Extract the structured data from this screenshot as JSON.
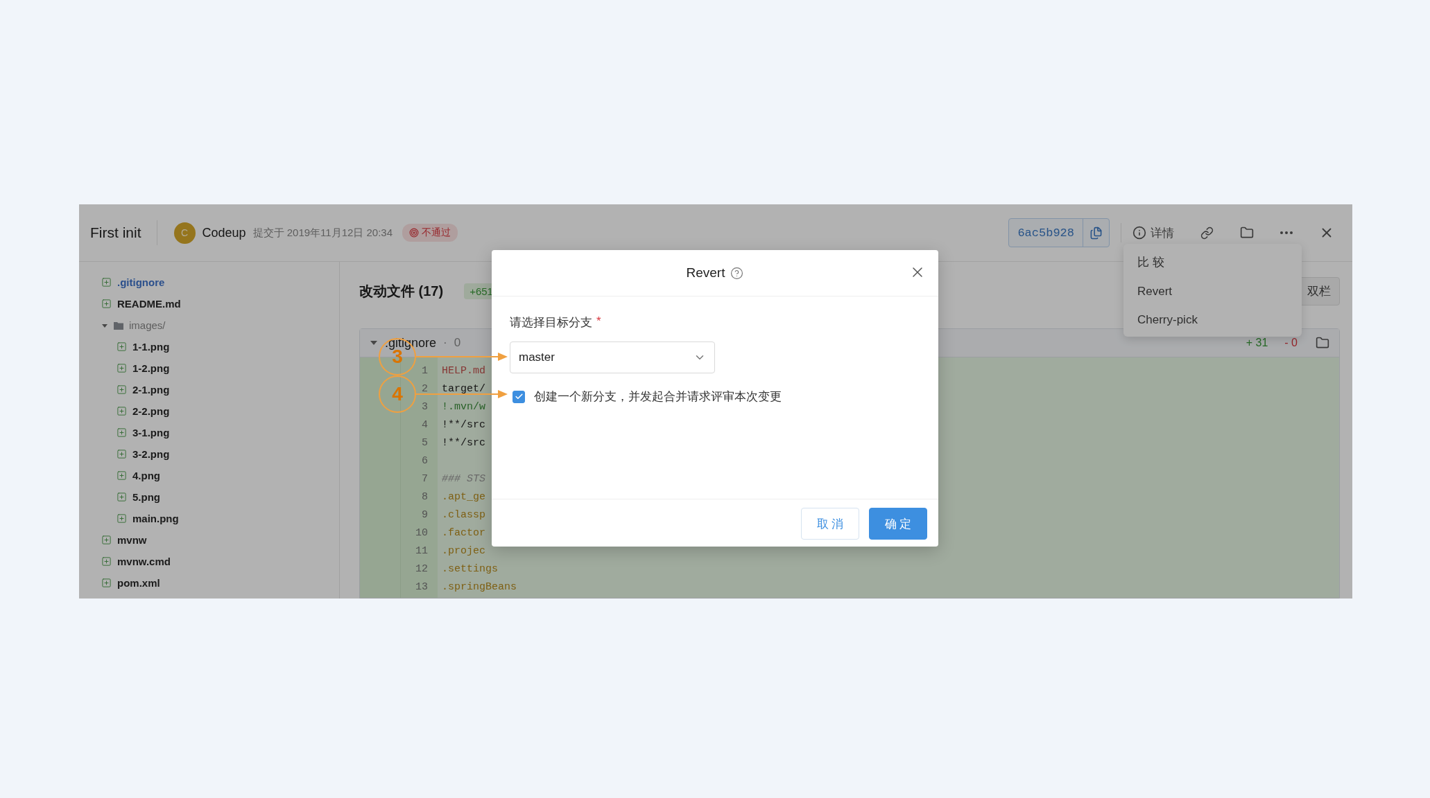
{
  "commit": {
    "title": "First init",
    "author_initial": "C",
    "author": "Codeup",
    "committed_at": "提交于 2019年11月12日 20:34",
    "status": "不通过",
    "hash": "6ac5b928"
  },
  "toolbar": {
    "details": "详情"
  },
  "more_menu": {
    "items": [
      {
        "label": "比 较"
      },
      {
        "label": "Revert"
      },
      {
        "label": "Cherry-pick"
      }
    ]
  },
  "file_tree": [
    {
      "name": ".gitignore",
      "kind": "file",
      "selected": true
    },
    {
      "name": "README.md",
      "kind": "file",
      "selected": false
    },
    {
      "name": "images/",
      "kind": "folder",
      "expanded": true,
      "children": [
        {
          "name": "1-1.png",
          "kind": "file",
          "selected": false
        },
        {
          "name": "1-2.png",
          "kind": "file",
          "selected": false
        },
        {
          "name": "2-1.png",
          "kind": "file",
          "selected": false
        },
        {
          "name": "2-2.png",
          "kind": "file",
          "selected": false
        },
        {
          "name": "3-1.png",
          "kind": "file",
          "selected": false
        },
        {
          "name": "3-2.png",
          "kind": "file",
          "selected": false
        },
        {
          "name": "4.png",
          "kind": "file",
          "selected": false
        },
        {
          "name": "5.png",
          "kind": "file",
          "selected": false
        },
        {
          "name": "main.png",
          "kind": "file",
          "selected": false
        }
      ]
    },
    {
      "name": "mvnw",
      "kind": "file",
      "selected": false
    },
    {
      "name": "mvnw.cmd",
      "kind": "file",
      "selected": false
    },
    {
      "name": "pom.xml",
      "kind": "file",
      "selected": false
    }
  ],
  "changes": {
    "title": "改动文件 (17)",
    "additions": "+651",
    "view_mode": "双栏"
  },
  "diff": {
    "file": ".gitignore",
    "separator": "·",
    "count": "0",
    "expanded": true,
    "added": "+ 31",
    "removed": "- 0",
    "lines": [
      {
        "number": "1",
        "code": "HELP.md",
        "kind": "heading"
      },
      {
        "number": "2",
        "code": "target/",
        "kind": "plain"
      },
      {
        "number": "3",
        "code": "!.mvn/w",
        "kind": "negated"
      },
      {
        "number": "4",
        "code": "!**/src",
        "kind": "plain"
      },
      {
        "number": "5",
        "code": "!**/src",
        "kind": "plain"
      },
      {
        "number": "6",
        "kind": "blank"
      },
      {
        "number": "7",
        "code": "### STS",
        "kind": "comment"
      },
      {
        "number": "8",
        "code": ".apt_ge",
        "kind": "entry"
      },
      {
        "number": "9",
        "code": ".classp",
        "kind": "entry"
      },
      {
        "number": "10",
        "code": ".factor",
        "kind": "entry"
      },
      {
        "number": "11",
        "code": ".projec",
        "kind": "entry"
      },
      {
        "number": "12",
        "code": ".settings",
        "kind": "entry"
      },
      {
        "number": "13",
        "code": ".springBeans",
        "kind": "entry"
      }
    ]
  },
  "dialog": {
    "title": "Revert",
    "field_label": "请选择目标分支",
    "required": true,
    "required_mark": "*",
    "branch": "master",
    "create_branch": {
      "label": "创建一个新分支，并发起合并请求评审本次变更",
      "checked": true
    },
    "buttons": [
      {
        "label": "取 消",
        "kind": "default"
      },
      {
        "label": "确 定",
        "kind": "primary"
      }
    ]
  },
  "annotations": [
    {
      "label": "3"
    },
    {
      "label": "4"
    }
  ]
}
